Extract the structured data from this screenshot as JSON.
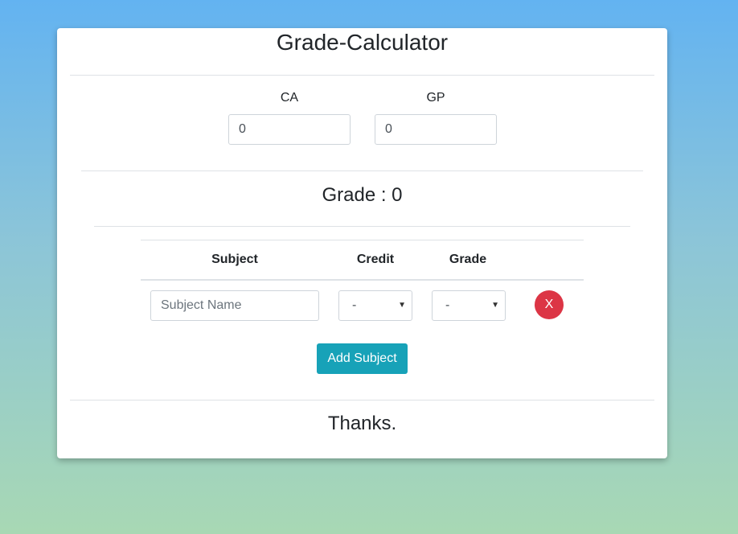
{
  "app": {
    "title": "Grade-Calculator"
  },
  "inputs": {
    "ca": {
      "label": "CA",
      "value": "0"
    },
    "gp": {
      "label": "GP",
      "value": "0"
    }
  },
  "result": {
    "text": "Grade : 0"
  },
  "table": {
    "headers": [
      "Subject",
      "Credit",
      "Grade"
    ],
    "rows": [
      {
        "subject_placeholder": "Subject Name",
        "subject_value": "",
        "credit": "-",
        "grade": "-",
        "remove_label": "X"
      }
    ]
  },
  "actions": {
    "add_subject_label": "Add Subject"
  },
  "footer": {
    "text": "Thanks."
  },
  "colors": {
    "remove": "#dc3545",
    "add": "#17a2b8"
  },
  "icons": {
    "select_caret": "caret-down-icon"
  }
}
